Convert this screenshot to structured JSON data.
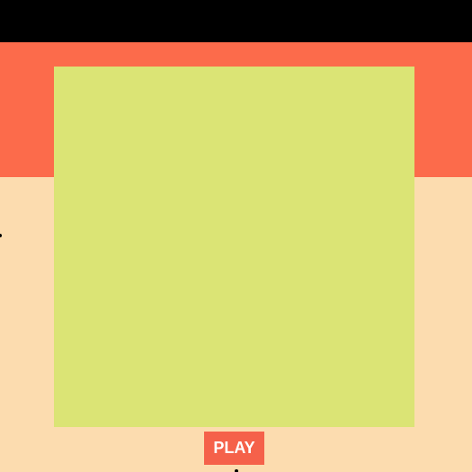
{
  "colors": {
    "top_bar": "#000000",
    "red_band": "#fc6b4b",
    "peach_area": "#fcdcaf",
    "board": "#dbe475",
    "play_button_bg": "#f5614a",
    "play_button_text": "#ffffff"
  },
  "controls": {
    "play_label": "PLAY"
  }
}
